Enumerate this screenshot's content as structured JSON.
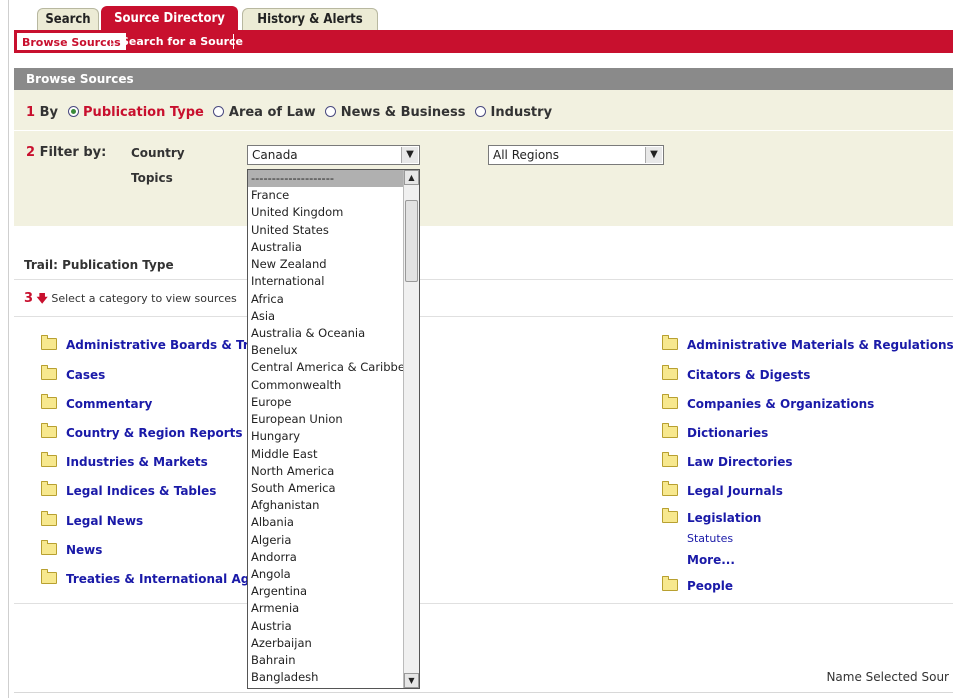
{
  "tabs": [
    {
      "label": "Search",
      "active": false
    },
    {
      "label": "Source Directory",
      "active": true
    },
    {
      "label": "History & Alerts",
      "active": false
    }
  ],
  "subtabs": [
    {
      "label": "Browse Sources",
      "active": true
    },
    {
      "label": "Search for a Source",
      "active": false
    }
  ],
  "panel_title": "Browse Sources",
  "step1": {
    "num": "1",
    "by_label": "By",
    "options": [
      {
        "label": "Publication Type",
        "selected": true
      },
      {
        "label": "Area of Law",
        "selected": false
      },
      {
        "label": "News & Business",
        "selected": false
      },
      {
        "label": "Industry",
        "selected": false
      }
    ]
  },
  "step2": {
    "num": "2",
    "filter_label": "Filter by:",
    "country_label": "Country",
    "topics_label": "Topics",
    "country_value": "Canada",
    "region_value": "All Regions"
  },
  "trail": {
    "label": "Trail:",
    "value": "Publication Type"
  },
  "step3": {
    "num": "3",
    "text": "Select a category to view sources"
  },
  "categories_left": [
    "Administrative Boards & Tribunals",
    "Cases",
    "Commentary",
    "Country & Region Reports",
    "Industries & Markets",
    "Legal Indices & Tables",
    "Legal News",
    "News",
    "Treaties & International Agreements"
  ],
  "categories_right": [
    "Administrative Materials & Regulations",
    "Citators & Digests",
    "Companies & Organizations",
    "Dictionaries",
    "Law Directories",
    "Legal Journals",
    "Legislation",
    "People"
  ],
  "legislation_sub": {
    "statutes": "Statutes",
    "more": "More..."
  },
  "country_options": [
    "--------------------",
    "France",
    "United Kingdom",
    "United States",
    "Australia",
    "New Zealand",
    "International",
    "Africa",
    "Asia",
    "Australia & Oceania",
    "Benelux",
    "Central America & Caribbean",
    "Commonwealth",
    "Europe",
    "European Union",
    "Hungary",
    "Middle East",
    "North America",
    "South America",
    "Afghanistan",
    "Albania",
    "Algeria",
    "Andorra",
    "Angola",
    "Argentina",
    "Armenia",
    "Austria",
    "Azerbaijan",
    "Bahrain",
    "Bangladesh"
  ],
  "footer_text": "Name Selected Sour",
  "icons": {
    "radio_selected": "radio-selected-icon",
    "radio": "radio-icon",
    "folder": "folder-icon",
    "dropdown_arrow": "chevron-down-icon",
    "red_arrow": "arrow-down-icon"
  },
  "colors": {
    "brand_red": "#c8102e",
    "link_blue": "#1a1aa8",
    "panel_bg": "#f2f1e0",
    "header_gray": "#8a8a8a"
  }
}
